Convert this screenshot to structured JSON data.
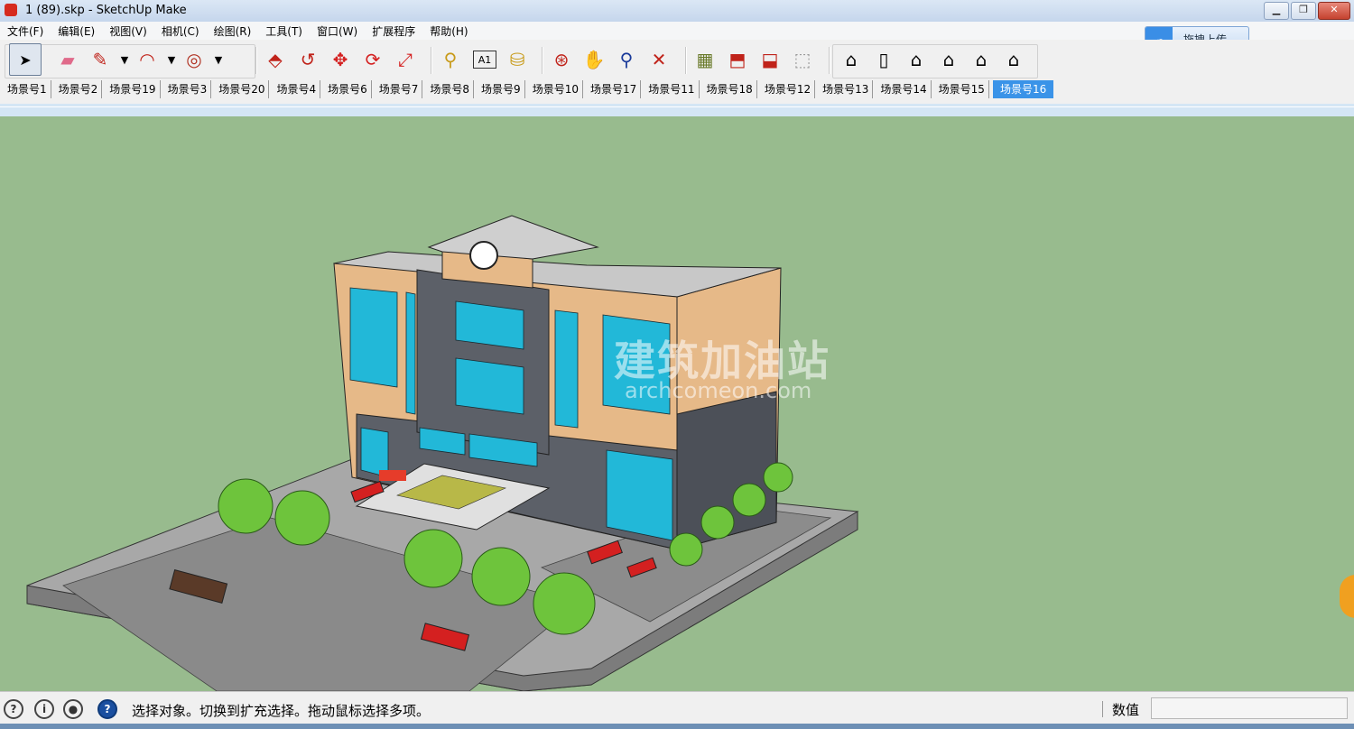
{
  "window": {
    "title": "1 (89).skp - SketchUp Make",
    "minimize_label": "▁",
    "restore_label": "❐",
    "close_label": "✕"
  },
  "menu": {
    "items": [
      "文件(F)",
      "编辑(E)",
      "视图(V)",
      "相机(C)",
      "绘图(R)",
      "工具(T)",
      "窗口(W)",
      "扩展程序",
      "帮助(H)"
    ]
  },
  "upload": {
    "label": "拖拽上传",
    "icon": "cloud-upload-icon"
  },
  "toolbar": {
    "tools": [
      {
        "name": "select-tool",
        "icon": "arrow-cursor-icon",
        "glyph": "➤",
        "active": true
      },
      {
        "name": "eraser-tool",
        "icon": "eraser-icon",
        "glyph": "▰"
      },
      {
        "name": "pencil-tool",
        "icon": "pencil-icon",
        "glyph": "✎"
      },
      {
        "name": "arc-tool",
        "icon": "arc-icon",
        "glyph": "◠"
      },
      {
        "name": "shape-tool",
        "icon": "circle-shape-icon",
        "glyph": "◎"
      },
      {
        "name": "push-pull-tool",
        "icon": "push-pull-icon",
        "glyph": "⬘"
      },
      {
        "name": "follow-me-tool",
        "icon": "follow-me-icon",
        "glyph": "↺"
      },
      {
        "name": "move-tool",
        "icon": "move-icon",
        "glyph": "✥"
      },
      {
        "name": "rotate-tool",
        "icon": "rotate-icon",
        "glyph": "⟳"
      },
      {
        "name": "scale-tool",
        "icon": "scale-icon",
        "glyph": "⤢"
      },
      {
        "name": "tape-measure-tool",
        "icon": "tape-measure-icon",
        "glyph": "⚲"
      },
      {
        "name": "text-tool",
        "icon": "text-label-icon",
        "glyph": "A1"
      },
      {
        "name": "paint-bucket-tool",
        "icon": "paint-bucket-icon",
        "glyph": "⛁"
      },
      {
        "name": "orbit-tool",
        "icon": "orbit-icon",
        "glyph": "⊛"
      },
      {
        "name": "pan-tool",
        "icon": "pan-hand-icon",
        "glyph": "✋"
      },
      {
        "name": "zoom-tool",
        "icon": "zoom-icon",
        "glyph": "⚲"
      },
      {
        "name": "zoom-extents-tool",
        "icon": "zoom-extents-icon",
        "glyph": "✕"
      },
      {
        "name": "warehouse-tool",
        "icon": "3d-warehouse-icon",
        "glyph": "▦"
      },
      {
        "name": "share-model-tool",
        "icon": "share-model-icon",
        "glyph": "⬒"
      },
      {
        "name": "get-models-tool",
        "icon": "get-models-icon",
        "glyph": "⬓"
      },
      {
        "name": "extension-warehouse-tool",
        "icon": "extension-warehouse-icon",
        "glyph": "⬚"
      },
      {
        "name": "iso-view-tool",
        "icon": "iso-view-icon",
        "glyph": "⌂"
      },
      {
        "name": "top-view-tool",
        "icon": "top-view-icon",
        "glyph": "▯"
      },
      {
        "name": "front-view-tool",
        "icon": "front-view-icon",
        "glyph": "⌂"
      },
      {
        "name": "right-view-tool",
        "icon": "right-view-icon",
        "glyph": "⌂"
      },
      {
        "name": "back-view-tool",
        "icon": "back-view-icon",
        "glyph": "⌂"
      },
      {
        "name": "left-view-tool",
        "icon": "left-view-icon",
        "glyph": "⌂"
      }
    ]
  },
  "scenes": {
    "tabs": [
      "场景号1",
      "场景号2",
      "场景号19",
      "场景号3",
      "场景号20",
      "场景号4",
      "场景号6",
      "场景号7",
      "场景号8",
      "场景号9",
      "场景号10",
      "场景号17",
      "场景号11",
      "场景号18",
      "场景号12",
      "场景号13",
      "场景号14",
      "场景号15"
    ],
    "active": "场景号16"
  },
  "viewport": {
    "watermark_cn": "建筑加油站",
    "watermark_en": "archcomeon.com",
    "background_color": "#98bb8e"
  },
  "status": {
    "message": "选择对象。切换到扩充选择。拖动鼠标选择多项。",
    "measure_label": "数值",
    "measure_value": ""
  }
}
